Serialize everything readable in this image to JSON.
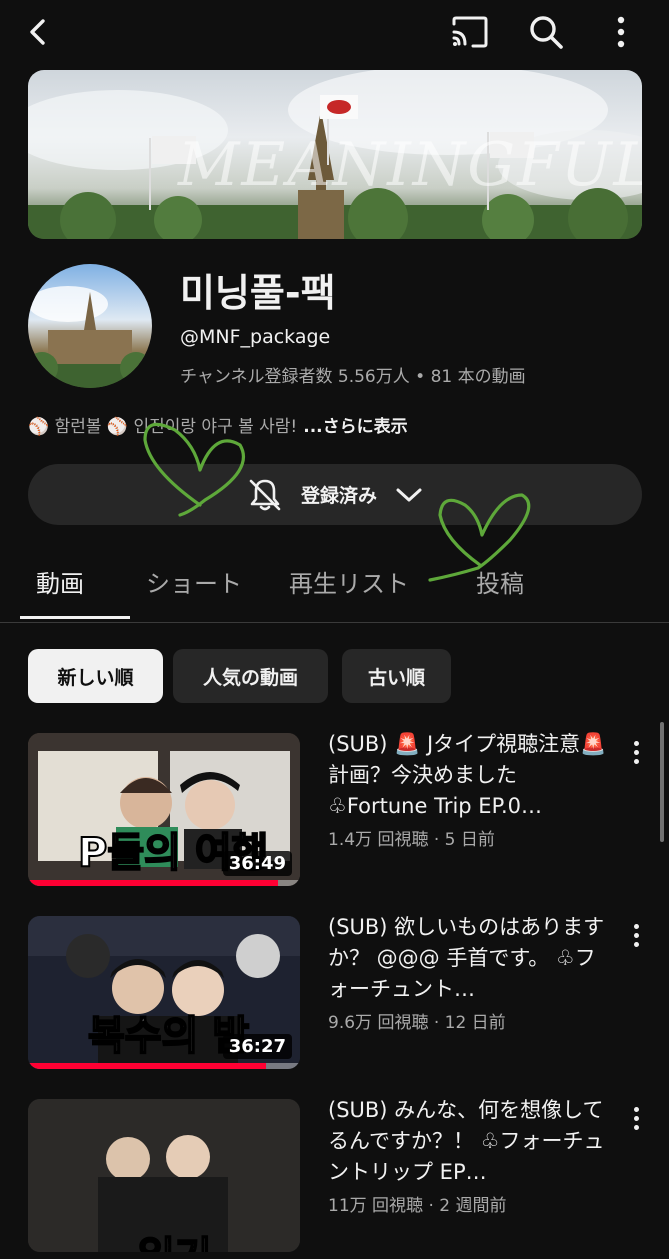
{
  "topbar": {
    "icons": [
      "back-icon",
      "cast-icon",
      "search-icon",
      "more-vert-icon"
    ]
  },
  "channel": {
    "banner_text": "MEANINGFUL",
    "name": "미닝풀-팩",
    "handle": "@MNF_package",
    "stats": "チャンネル登録者数 5.56万人 • 81 本の動画",
    "description": "⚾ 함런볼 ⚾ 인진이랑 야구 볼 사람!",
    "more": "...さらに表示",
    "subscribe_label": "登録済み"
  },
  "tabs": [
    {
      "label": "動画",
      "active": true
    },
    {
      "label": "ショート",
      "active": false
    },
    {
      "label": "再生リスト",
      "active": false
    },
    {
      "label": "投稿",
      "active": false
    }
  ],
  "chips": [
    {
      "label": "新しい順",
      "active": true
    },
    {
      "label": "人気の動画",
      "active": false
    },
    {
      "label": "古い順",
      "active": false
    }
  ],
  "videos": [
    {
      "title": "(SUB) 🚨 Jタイプ視聴注意🚨 計画？今決めました ♧Fortune Trip EP.0…",
      "meta": "1.4万 回視聴 · 5 日前",
      "duration": "36:49",
      "thumb_text": "P들의 여행",
      "progress": 0.92
    },
    {
      "title": "(SUB) 欲しいものはありますか？ @@@ 手首です。 ♧フォーチュント…",
      "meta": "9.6万 回視聴 · 12 日前",
      "duration": "36:27",
      "thumb_text": "복수의 밤",
      "progress": 0.88
    },
    {
      "title": "(SUB) みんな、何を想像してるんですか？！ ♧フォーチュントリップ EP…",
      "meta": "11万 回視聴 · 2 週間前",
      "duration": "",
      "thumb_text": "일기",
      "progress": 0
    }
  ],
  "colors": {
    "background": "#0f0f0f",
    "surface": "#272727",
    "text_primary": "#f1f1f1",
    "text_secondary": "#aaaaaa",
    "progress": "#ff0033",
    "doodle": "#5ea83a"
  }
}
